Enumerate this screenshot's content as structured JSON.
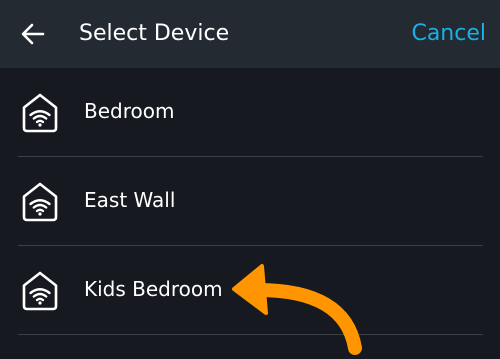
{
  "header": {
    "back_icon": "arrow-left-icon",
    "title": "Select Device",
    "cancel_label": "Cancel"
  },
  "devices": [
    {
      "label": "Bedroom",
      "icon": "smart-home-wifi-icon"
    },
    {
      "label": "East Wall",
      "icon": "smart-home-wifi-icon"
    },
    {
      "label": "Kids Bedroom",
      "icon": "smart-home-wifi-icon"
    }
  ],
  "annotation": {
    "icon": "curved-arrow-icon",
    "color": "#ff9500"
  },
  "colors": {
    "background": "#16191f",
    "header": "#232a31",
    "accent": "#19b0e3"
  }
}
